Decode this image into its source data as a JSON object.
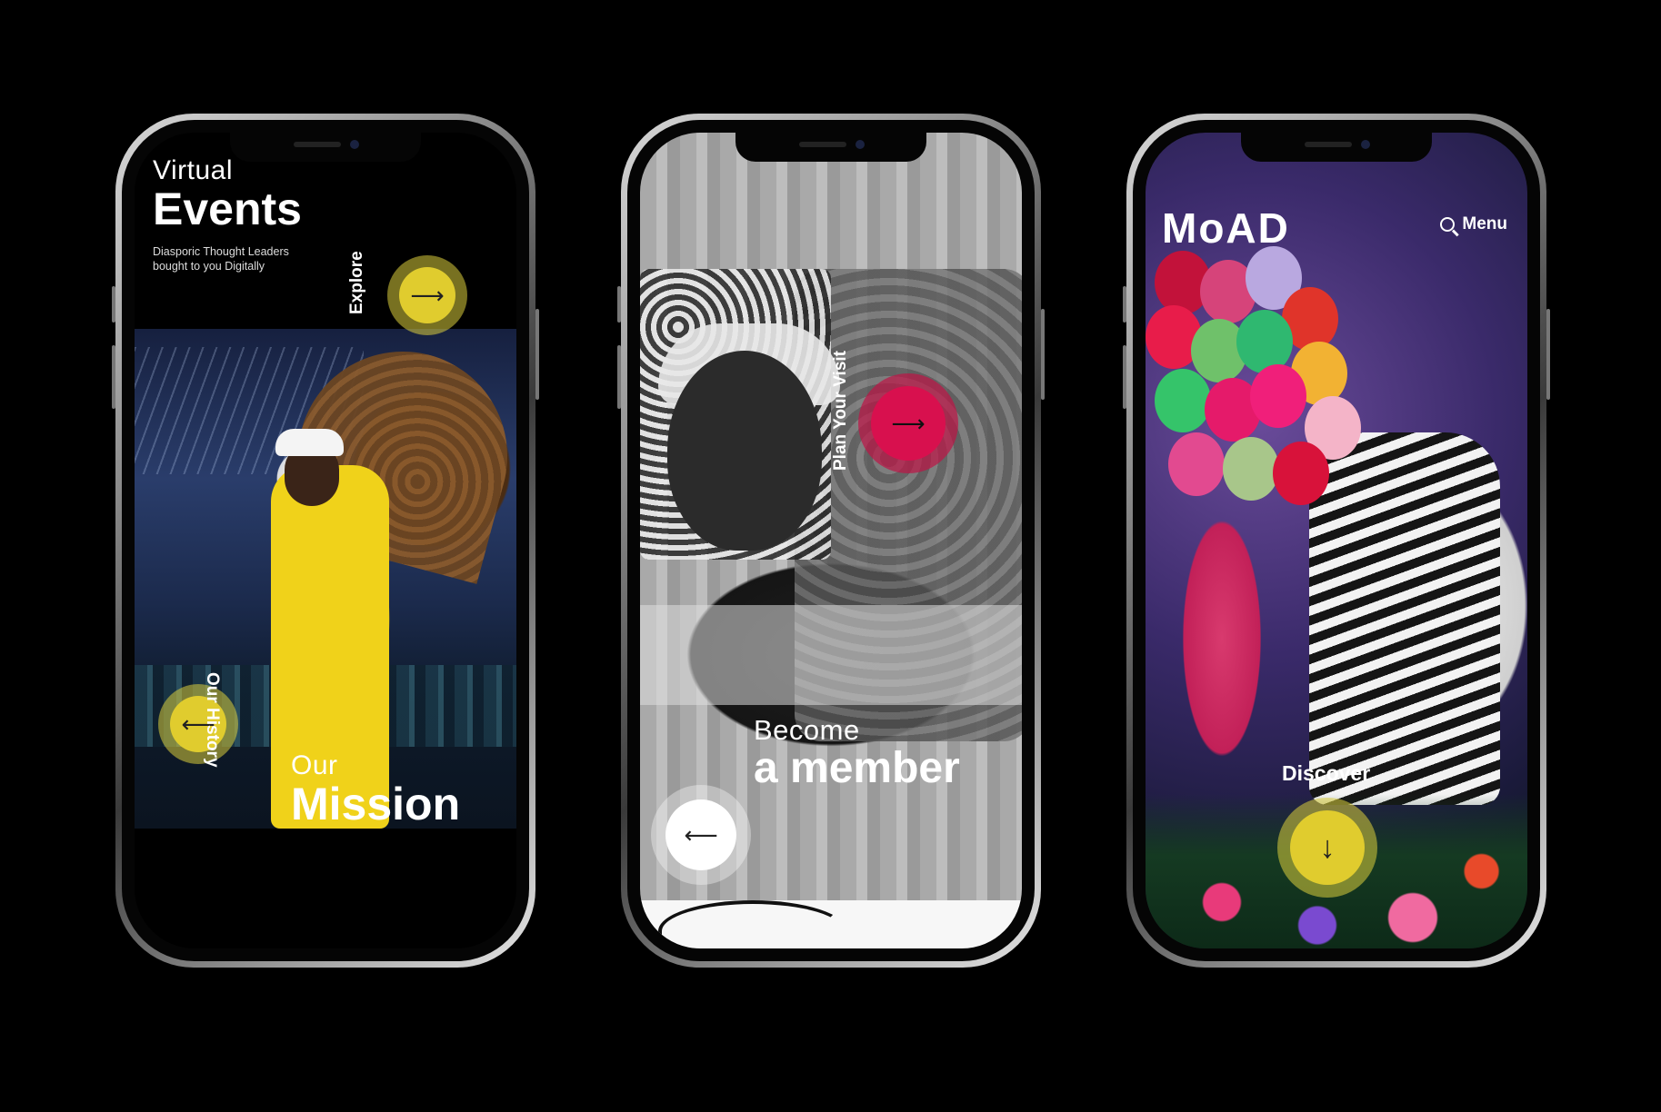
{
  "phone1": {
    "title_light": "Virtual",
    "title_bold": "Events",
    "subtitle_line1": "Diasporic Thought Leaders",
    "subtitle_line2": "bought to you Digitally",
    "explore_label": "Explore",
    "history_label": "Our History",
    "mission_light": "Our",
    "mission_bold": "Mission",
    "forward_arrow": "⟶",
    "back_arrow": "⟵"
  },
  "phone2": {
    "visit_label": "Plan Your Visit",
    "member_light": "Become",
    "member_bold": "a member",
    "forward_arrow": "⟶",
    "back_arrow": "⟵"
  },
  "phone3": {
    "logo": "MoAD",
    "menu_label": "Menu",
    "discover_label": "Discover",
    "down_arrow": "↓"
  },
  "colors": {
    "background": "#000000",
    "accent_yellow": "#e0cc2e",
    "accent_pink": "#d8104e",
    "text": "#ffffff"
  }
}
